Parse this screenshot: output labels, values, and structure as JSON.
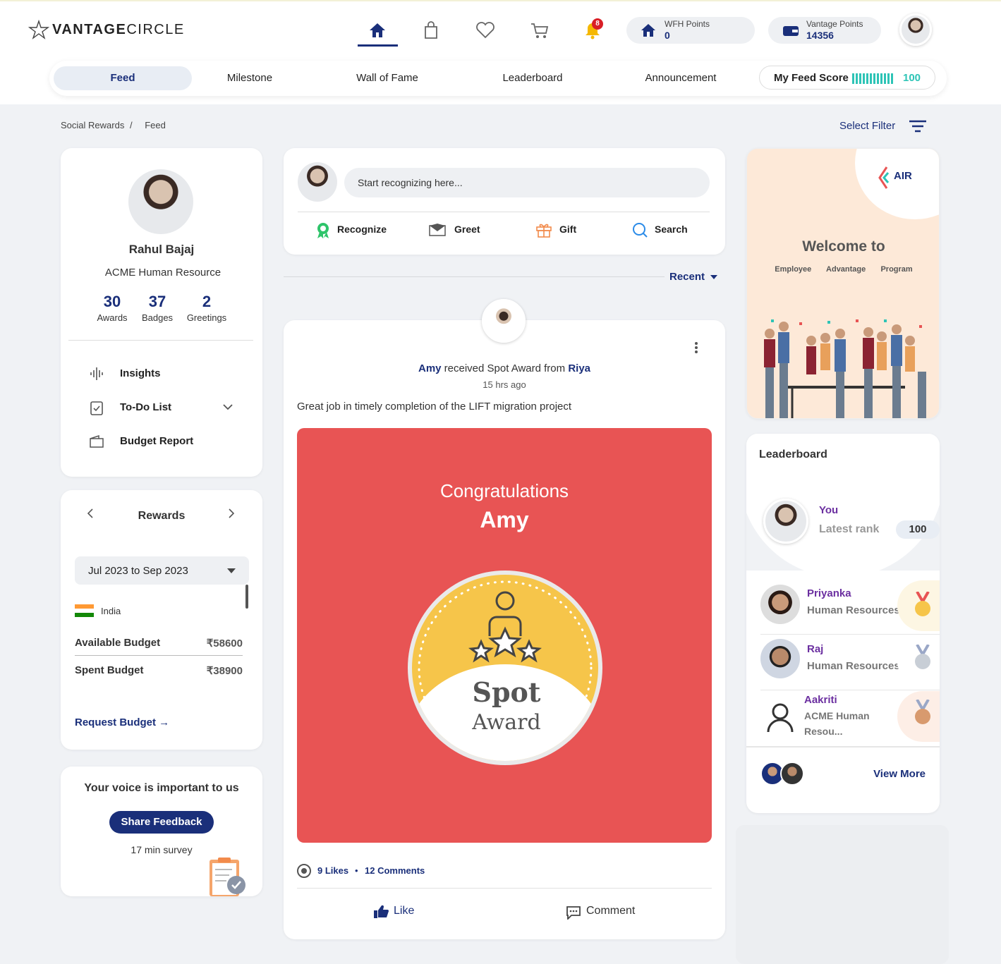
{
  "header": {
    "logo_bold": "VANTAGE",
    "logo_light": "CIRCLE",
    "notification_count": "8",
    "wfh_points_label": "WFH Points",
    "wfh_points_value": "0",
    "vantage_points_label": "Vantage Points",
    "vantage_points_value": "14356"
  },
  "subnav": {
    "tabs": [
      "Feed",
      "Milestone",
      "Wall of Fame",
      "Leaderboard",
      "Announcement"
    ],
    "feed_score_label": "My Feed Score",
    "feed_score_value": "100"
  },
  "breadcrumb": {
    "root": "Social Rewards",
    "separator": "/",
    "current": "Feed"
  },
  "filter": {
    "label": "Select Filter"
  },
  "profile": {
    "name": "Rahul Bajaj",
    "company": "ACME Human Resource",
    "stats": [
      {
        "value": "30",
        "label": "Awards"
      },
      {
        "value": "37",
        "label": "Badges"
      },
      {
        "value": "2",
        "label": "Greetings"
      }
    ],
    "menu": [
      "Insights",
      "To-Do List",
      "Budget Report"
    ]
  },
  "rewards": {
    "title": "Rewards",
    "period": "Jul 2023 to Sep 2023",
    "country": "India",
    "available_label": "Available Budget",
    "available_value": "₹58600",
    "spent_label": "Spent Budget",
    "spent_value": "₹38900",
    "request_label": "Request Budget →"
  },
  "feedback": {
    "title": "Your voice is important to us",
    "button": "Share Feedback",
    "note": "17 min survey"
  },
  "composer": {
    "placeholder": "Start recognizing here...",
    "actions": [
      "Recognize",
      "Greet",
      "Gift",
      "Search"
    ]
  },
  "sort": {
    "label": "Recent"
  },
  "post": {
    "recipient": "Amy",
    "action": " received Spot Award from ",
    "sender": "Riya",
    "time": "15 hrs ago",
    "message": "Great job in timely completion of the LIFT migration project",
    "banner_title": "Congratulations",
    "banner_name": "Amy",
    "badge_line1": "Spot",
    "badge_line2": "Award",
    "likes": "9 Likes",
    "dot": "•",
    "comments": "12 Comments",
    "like_btn": "Like",
    "comment_btn": "Comment"
  },
  "promo": {
    "brand": "AIR",
    "title": "Welcome to",
    "words": [
      "Employee",
      "Advantage",
      "Program"
    ]
  },
  "leaderboard": {
    "title": "Leaderboard",
    "you_label": "You",
    "rank_label": "Latest rank",
    "rank_value": "100",
    "entries": [
      {
        "name": "Priyanka",
        "dept": "Human Resources"
      },
      {
        "name": "Raj",
        "dept": "Human Resources"
      },
      {
        "name": "Aakriti",
        "dept": "ACME Human Resou..."
      }
    ],
    "view_more": "View More"
  },
  "colors": {
    "primary": "#1a2f7a",
    "accent_teal": "#2ec4b6",
    "banner_red": "#e85454",
    "badge_yellow": "#f6c54a",
    "purple": "#6b2fa0"
  }
}
